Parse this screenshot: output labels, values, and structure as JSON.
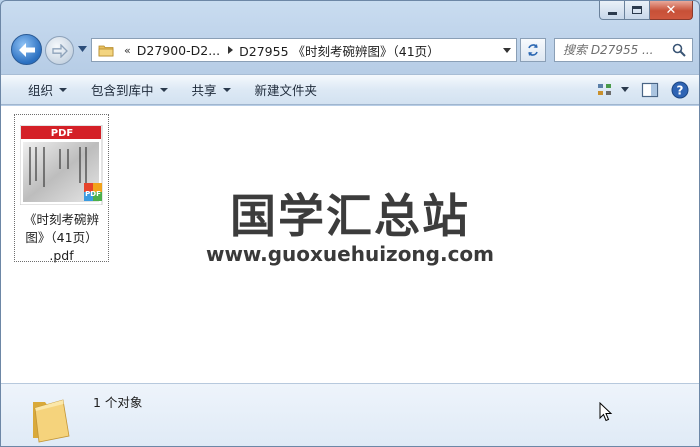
{
  "addressbar": {
    "overflow": "«",
    "crumb1": "D27900-D2...",
    "crumb2": "D27955 《时刻考碗辨图》（41页）"
  },
  "search": {
    "placeholder": "搜索 D27955 ..."
  },
  "commands": {
    "organize": "组织",
    "include_library": "包含到库中",
    "share": "共享",
    "new_folder": "新建文件夹"
  },
  "file": {
    "thumb_badge": "PDF",
    "corner_badge": "PDF",
    "name_line1": "《时刻考碗辨",
    "name_line2": "图》（41页）",
    "name_line3": ".pdf"
  },
  "watermark": {
    "cn": "国学汇总站",
    "url": "www.guoxuehuizong.com"
  },
  "details": {
    "count_text": "1 个对象"
  },
  "colors": {
    "accent": "#2a6fc0",
    "pdf_red": "#d42027"
  }
}
